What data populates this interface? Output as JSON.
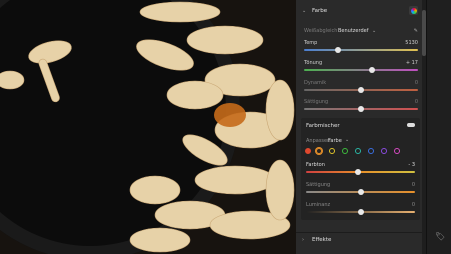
{
  "panel": {
    "section_title": "Farbe",
    "wb_label": "Weißabgleich",
    "wb_value": "Benutzerdef",
    "temp_label": "Temp",
    "temp_value": "5130",
    "temp_level": 0.3,
    "tint_label": "Tönung",
    "tint_value": "+ 17",
    "tint_level": 0.6,
    "vibrance_label": "Dynamik",
    "vibrance_value": "0",
    "vibrance_level": 0.5,
    "saturation_label": "Sättigung",
    "saturation_value": "0",
    "saturation_level": 0.5
  },
  "mixer": {
    "title": "Farbmischer",
    "adjust_label": "Anpassen",
    "adjust_value": "Farbe",
    "hue_label": "Farbton",
    "hue_value": "- 3",
    "hue_level": 0.48,
    "sat_label": "Sättigung",
    "sat_value": "0",
    "sat_level": 0.5,
    "lum_label": "Luminanz",
    "lum_value": "0",
    "lum_level": 0.5,
    "swatches": [
      "#e0482e",
      "#e7902a",
      "#e0c52a",
      "#3dbb3d",
      "#2ab7a6",
      "#3a6fe0",
      "#8a4be0",
      "#d94bc4"
    ]
  },
  "effects": {
    "title": "Effekte"
  },
  "colors": {
    "accent": "#e7902a",
    "panel_bg": "#2a2a2a"
  }
}
